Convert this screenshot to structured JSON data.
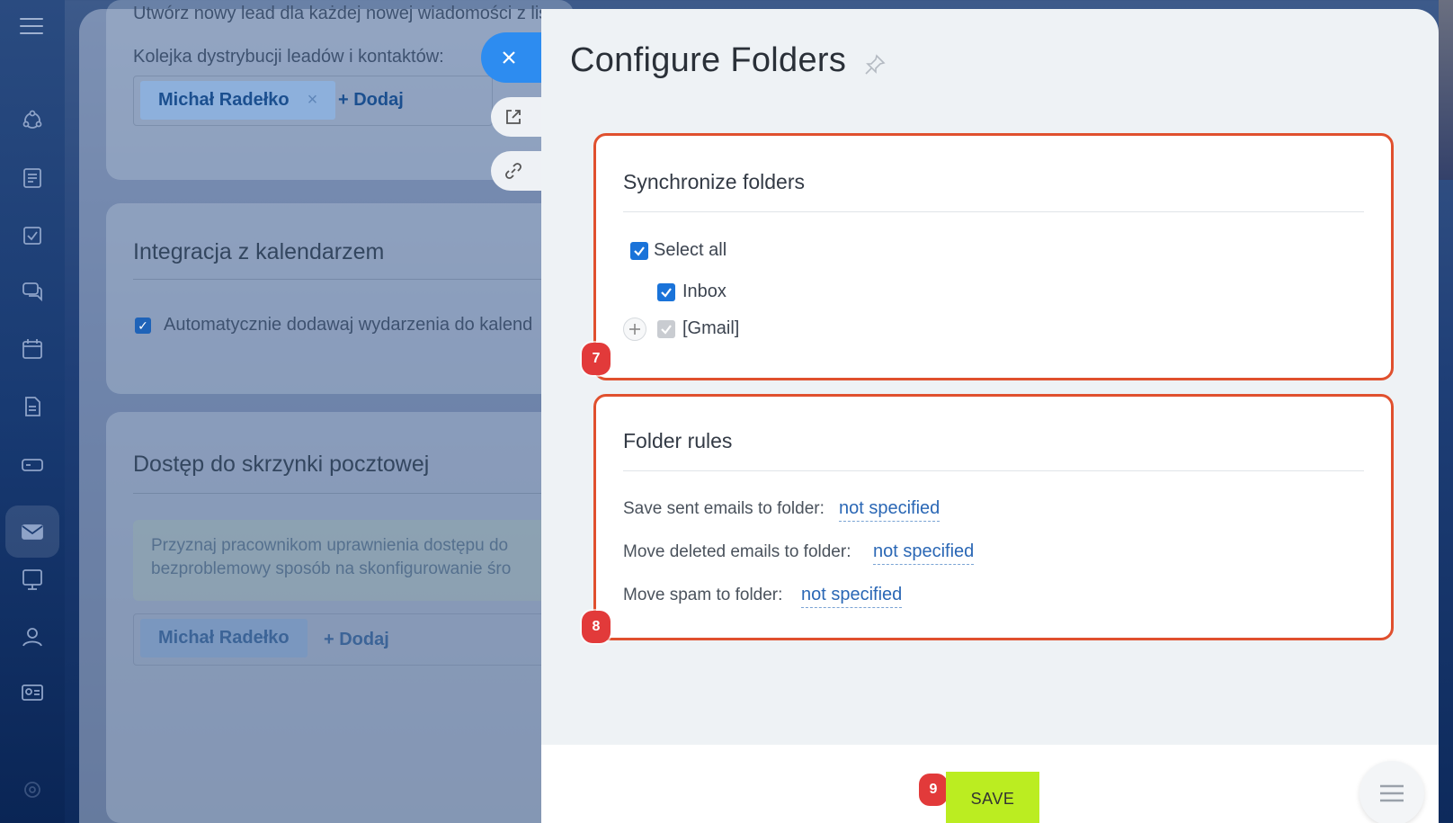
{
  "background": {
    "top_text": "Utwórz nowy lead dla każdej nowej wiadomości z lis",
    "queue_label": "Kolejka dystrybucji leadów i kontaktów:",
    "queue_user": "Michał Radełko",
    "queue_remove": "×",
    "add_label": "+ Dodaj",
    "calendar_heading": "Integracja z kalendarzem",
    "calendar_checkbox_label": "Automatycznie dodawaj wydarzenia do kalend",
    "mailbox_heading": "Dostęp do skrzynki pocztowej",
    "mailbox_info_line1": "Przyznaj pracownikom uprawnienia dostępu do",
    "mailbox_info_line2": "bezproblemowy sposób na skonfigurowanie śro",
    "mailbox_user": "Michał Radełko",
    "mailbox_add": "+ Dodaj"
  },
  "slider": {
    "title": "Configure Folders",
    "sync": {
      "title": "Synchronize folders",
      "select_all": "Select all",
      "folders": [
        {
          "label": "Inbox",
          "checked": true
        },
        {
          "label": "[Gmail]",
          "checked": true,
          "disabled": true
        }
      ],
      "badge": "7"
    },
    "rules": {
      "title": "Folder rules",
      "items": [
        {
          "label": "Save sent emails to folder:",
          "value": "not specified"
        },
        {
          "label": "Move deleted emails to folder:",
          "value": "not specified"
        },
        {
          "label": "Move spam to folder:",
          "value": "not specified"
        }
      ],
      "badge": "8"
    },
    "footer": {
      "save_label": "SAVE",
      "badge": "9"
    }
  },
  "colors": {
    "accent_blue": "#2d8cf0",
    "highlight_border": "#e0502e",
    "badge_red": "#e23a3a",
    "save_green": "#bbed21",
    "link_blue": "#2a67b5"
  },
  "icons": {
    "sidebar": [
      "hamburger-icon",
      "crm-icon",
      "feed-icon",
      "tasks-icon",
      "chat-icon",
      "calendar-icon",
      "documents-icon",
      "drive-icon",
      "mail-icon",
      "sites-icon",
      "employees-icon",
      "contacts-icon",
      "settings-icon"
    ],
    "side_buttons": [
      "close-icon",
      "external-link-icon",
      "link-icon"
    ],
    "title": "pin-icon",
    "fab": "list-menu-icon"
  }
}
